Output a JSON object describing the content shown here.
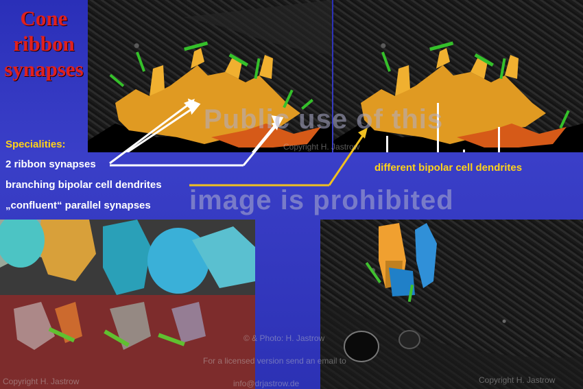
{
  "title": {
    "line1": "Cone",
    "line2": "ribbon",
    "line3": "synapses"
  },
  "specialities": {
    "heading": "Specialities:",
    "items": [
      "2 ribbon synapses",
      "branching bipolar cell dendrites",
      "„confluent“ parallel synapses"
    ]
  },
  "label_dendrites": "different bipolar cell dendrites",
  "watermark": {
    "line1": "Public use of this",
    "line2": "image is prohibited"
  },
  "copyright": {
    "top_right": "Copyright H. Jastrow",
    "bottom_left": "Copyright H. Jastrow",
    "bottom_right": "Copyright H. Jastrow",
    "photo": "© & Photo: H. Jastrow",
    "license": "For a licensed version send an email to",
    "email": "info@drjastrow.de"
  },
  "colors": {
    "background": "#2d32b8",
    "title": "#e0201e",
    "label": "#ffd21a",
    "arrow_white": "#ffffff",
    "arrow_yellow": "#f0c020"
  }
}
